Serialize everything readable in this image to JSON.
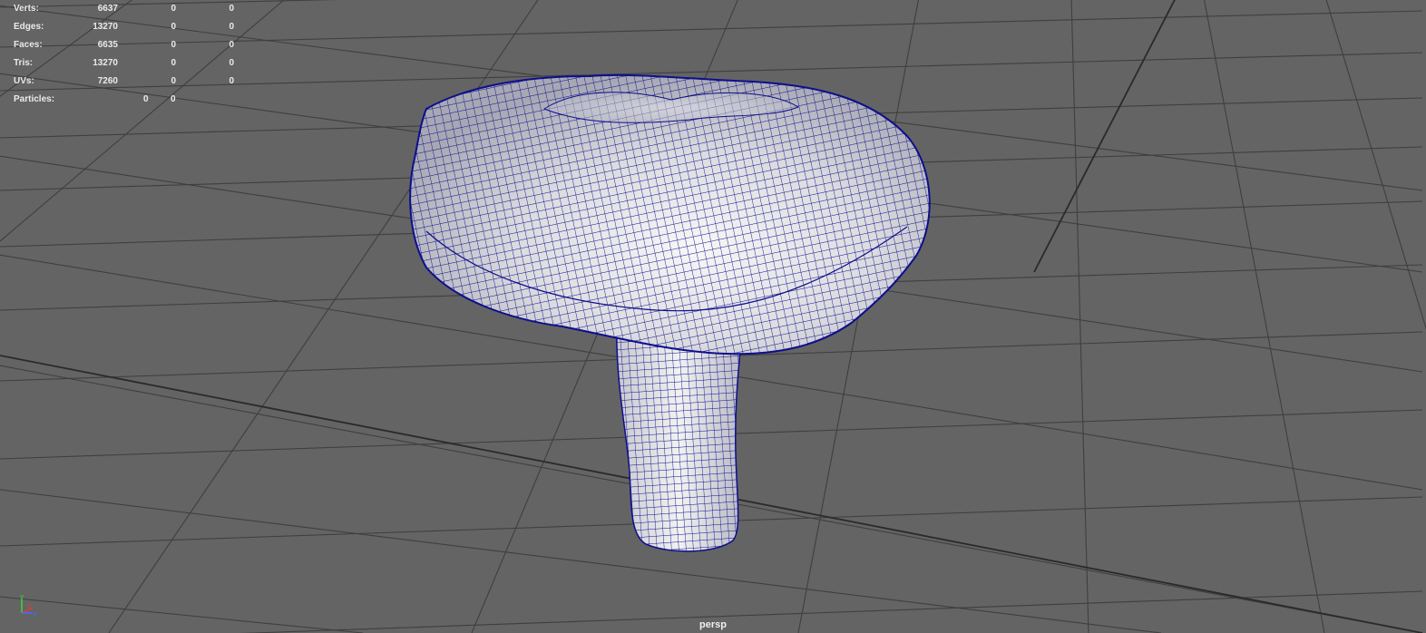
{
  "viewport": {
    "camera": "persp",
    "background_color": "#646464",
    "grid_color": "#3f3f3f",
    "wireframe_color": "#0d0f8c"
  },
  "hud": {
    "stats": [
      {
        "label": "Verts:",
        "v1": "6637",
        "v2": "0",
        "v3": "0"
      },
      {
        "label": "Edges:",
        "v1": "13270",
        "v2": "0",
        "v3": "0"
      },
      {
        "label": "Faces:",
        "v1": "6635",
        "v2": "0",
        "v3": "0"
      },
      {
        "label": "Tris:",
        "v1": "13270",
        "v2": "0",
        "v3": "0"
      },
      {
        "label": "UVs:",
        "v1": "7260",
        "v2": "0",
        "v3": "0"
      }
    ],
    "particles": {
      "label": "Particles:",
      "v1": "0",
      "v2": "0"
    }
  },
  "axis": {
    "y": "y",
    "x": "x",
    "z": "z",
    "icon": "axis-gizmo-icon"
  }
}
